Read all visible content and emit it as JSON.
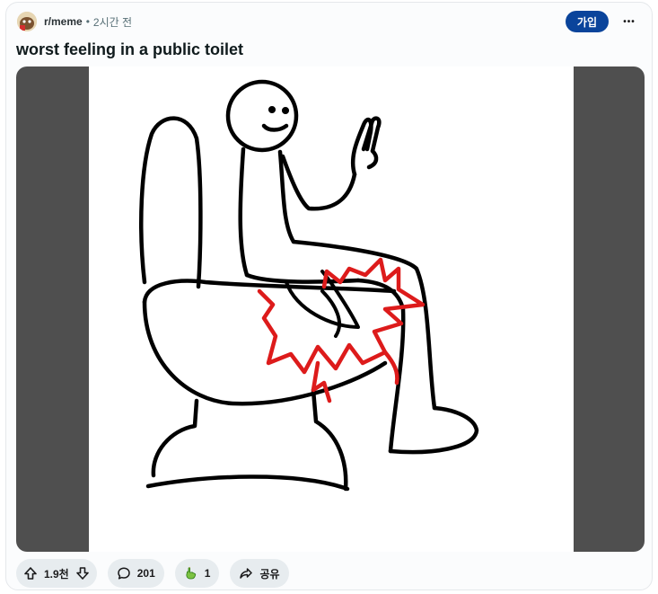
{
  "post": {
    "subreddit": "r/meme",
    "separator": "•",
    "time_ago": "2시간 전",
    "title": "worst feeling in a public toilet",
    "join_label": "가입",
    "more_label": "•••"
  },
  "image": {
    "description_icon": "meme-drawing"
  },
  "actions": {
    "upvotes": "1.9천",
    "comments": "201",
    "awards": "1",
    "share_label": "공유"
  },
  "colors": {
    "join_button": "#0a449b",
    "pill_bg": "#e7ecef",
    "media_bg": "#4f4f4f",
    "drawing_red": "#dd1b1b"
  }
}
